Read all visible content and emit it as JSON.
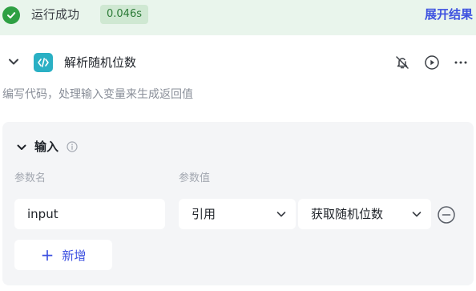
{
  "status": {
    "text": "运行成功",
    "duration": "0.046s",
    "expand_label": "展开结果"
  },
  "node": {
    "title": "解析随机位数",
    "description": "编写代码，处理输入变量来生成返回值",
    "actions": [
      "bell-off-icon",
      "play-icon",
      "more-icon"
    ]
  },
  "inputs": {
    "title": "输入",
    "col_name": "参数名",
    "col_value": "参数值",
    "rows": [
      {
        "name": "input",
        "type": "引用",
        "ref": "获取随机位数"
      }
    ],
    "add_label": "新增"
  },
  "colors": {
    "success": "#2ea043",
    "accent": "#3d51e0",
    "code_icon": "#2ab0c4",
    "card_bg": "#f4f5f7"
  }
}
